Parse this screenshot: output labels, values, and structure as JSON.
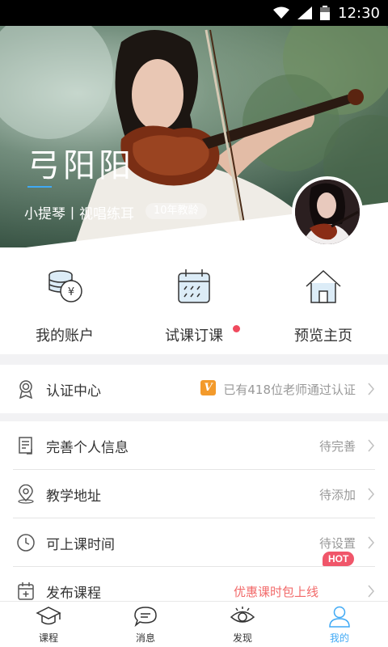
{
  "status_bar": {
    "time": "12:30"
  },
  "profile": {
    "name": "弓阳阳",
    "subject": "小提琴丨视唱练耳",
    "years_badge": "10年教龄"
  },
  "quick_actions": [
    {
      "label": "我的账户",
      "icon": "coins-icon",
      "badge_dot": false
    },
    {
      "label": "试课订课",
      "icon": "calendar-icon",
      "badge_dot": true
    },
    {
      "label": "预览主页",
      "icon": "home-icon",
      "badge_dot": false
    }
  ],
  "certification": {
    "title": "认证中心",
    "icon": "award-icon",
    "badge": "V",
    "value": "已有418位老师通过认证"
  },
  "settings_rows": [
    {
      "title": "完善个人信息",
      "icon": "document-icon",
      "value": "待完善"
    },
    {
      "title": "教学地址",
      "icon": "location-pin-icon",
      "value": "待添加"
    },
    {
      "title": "可上课时间",
      "icon": "clock-icon",
      "value": "待设置"
    },
    {
      "title": "发布课程",
      "icon": "calendar-plus-icon",
      "promo": "优惠课时包上线",
      "hot": "HOT"
    }
  ],
  "tabs": [
    {
      "label": "课程",
      "icon": "graduation-cap-icon",
      "active": false
    },
    {
      "label": "消息",
      "icon": "chat-bubble-icon",
      "active": false
    },
    {
      "label": "发现",
      "icon": "eye-icon",
      "active": false
    },
    {
      "label": "我的",
      "icon": "person-icon",
      "active": true
    }
  ],
  "colors": {
    "accent": "#3fa9f5",
    "badge_red": "#f04a5e",
    "v_badge": "#f39a2b",
    "promo": "#f26a6a"
  }
}
